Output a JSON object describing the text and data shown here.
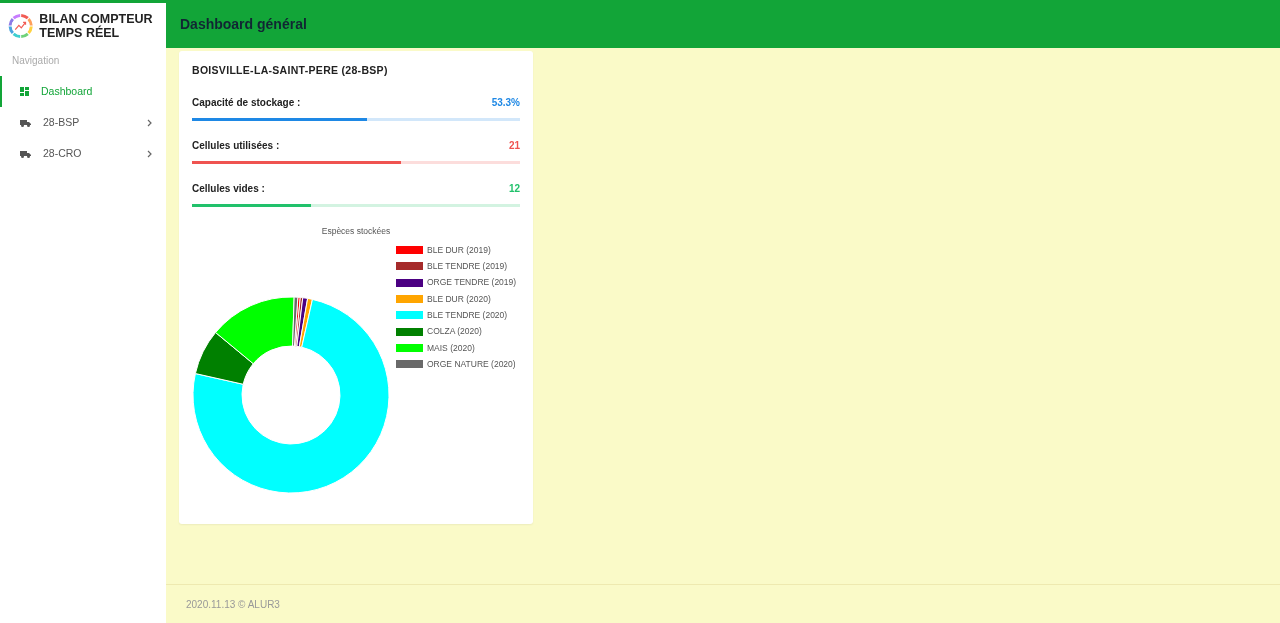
{
  "brand": {
    "title": "BILAN COMPTEUR TEMPS RÉEL"
  },
  "sidebar": {
    "heading": "Navigation",
    "items": [
      {
        "label": "Dashboard",
        "kind": "dashboard",
        "selected": true,
        "expandable": false
      },
      {
        "label": "28-BSP",
        "kind": "truck",
        "selected": false,
        "expandable": true
      },
      {
        "label": "28-CRO",
        "kind": "truck",
        "selected": false,
        "expandable": true
      }
    ]
  },
  "header": {
    "title": "Dashboard général"
  },
  "card": {
    "title": "BOISVILLE-LA-SAINT-PERE (28-BSP)",
    "meters": [
      {
        "label": "Capacité de stockage :",
        "reading": "53.3%",
        "level": 0.533,
        "color": "#1e88e5"
      },
      {
        "label": "Cellules utilisées :",
        "reading": "21",
        "level": 0.636,
        "color": "#ef5350"
      },
      {
        "label": "Cellules vides :",
        "reading": "12",
        "level": 0.364,
        "color": "#21c16b"
      }
    ],
    "chart": {
      "title": "Espèces stockées",
      "legend": [
        {
          "name": "BLE DUR (2019)",
          "color": "#ff0000"
        },
        {
          "name": "BLE TENDRE (2019)",
          "color": "#a52a2a"
        },
        {
          "name": "ORGE TENDRE (2019)",
          "color": "#4b0082"
        },
        {
          "name": "BLE DUR (2020)",
          "color": "#ffa500"
        },
        {
          "name": "BLE TENDRE (2020)",
          "color": "#00ffff"
        },
        {
          "name": "COLZA (2020)",
          "color": "#008000"
        },
        {
          "name": "MAIS (2020)",
          "color": "#00ff00"
        },
        {
          "name": "ORGE NATURE (2020)",
          "color": "#696969"
        }
      ]
    }
  },
  "footer": {
    "text": "2020.11.13 © ALUR3"
  }
}
